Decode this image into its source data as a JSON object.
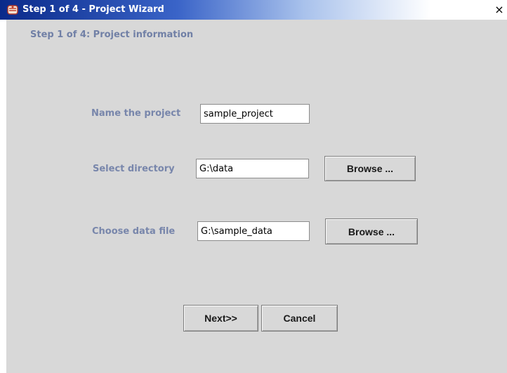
{
  "window": {
    "title": "Step 1 of 4 - Project Wizard",
    "app_icon": "java-duke-icon",
    "close_glyph": "×"
  },
  "heading": "Step 1 of 4: Project information",
  "form": {
    "project_name": {
      "label": "Name the project",
      "value": "sample_project"
    },
    "directory": {
      "label": "Select directory",
      "value": "G:\\data",
      "browse_label": "Browse ..."
    },
    "data_file": {
      "label": "Choose data file",
      "value": "G:\\sample_data",
      "browse_label": "Browse ..."
    }
  },
  "footer": {
    "next_label": "Next>>",
    "cancel_label": "Cancel"
  },
  "colors": {
    "label_text": "#7886ab",
    "panel_background": "#d8d8d8",
    "titlebar_start": "#0a2a8a"
  }
}
